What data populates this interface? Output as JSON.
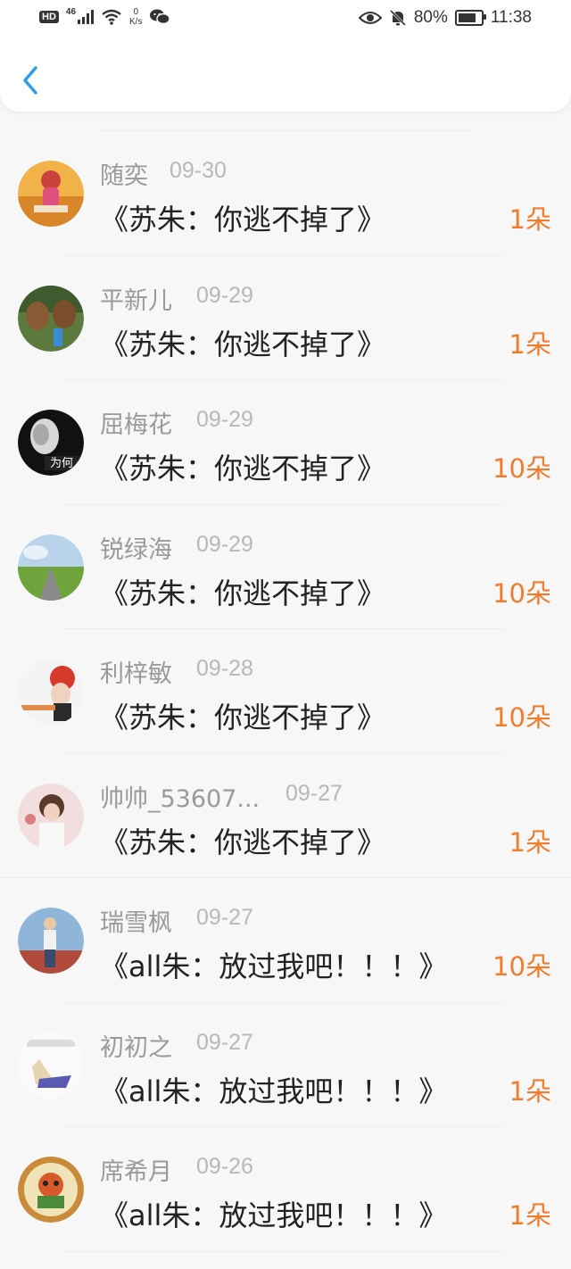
{
  "status_bar": {
    "hd": "HD",
    "network": "46",
    "speed_value": "0",
    "speed_unit": "K/s",
    "battery_percent": "80%",
    "battery_level": 0.8,
    "time": "11:38"
  },
  "list": {
    "items": [
      {
        "name": "随奕",
        "date": "09-30",
        "title": "《苏朱：你逃不掉了》",
        "count": "1朵"
      },
      {
        "name": "平新儿",
        "date": "09-29",
        "title": "《苏朱：你逃不掉了》",
        "count": "1朵"
      },
      {
        "name": "屈梅花",
        "date": "09-29",
        "title": "《苏朱：你逃不掉了》",
        "count": "10朵"
      },
      {
        "name": "锐绿海",
        "date": "09-29",
        "title": "《苏朱：你逃不掉了》",
        "count": "10朵"
      },
      {
        "name": "利梓敏",
        "date": "09-28",
        "title": "《苏朱：你逃不掉了》",
        "count": "10朵"
      },
      {
        "name": "帅帅_53607...",
        "date": "09-27",
        "title": "《苏朱：你逃不掉了》",
        "count": "1朵"
      },
      {
        "name": "瑞雪枫",
        "date": "09-27",
        "title": "《all朱：放过我吧！！！》",
        "count": "10朵"
      },
      {
        "name": "初初之",
        "date": "09-27",
        "title": "《all朱：放过我吧！！！》",
        "count": "1朵"
      },
      {
        "name": "席希月",
        "date": "09-26",
        "title": "《all朱：放过我吧！！！》",
        "count": "1朵"
      }
    ]
  },
  "colors": {
    "accent_blue": "#2d9cf0",
    "count_orange": "#f07c2c",
    "name_gray": "#9a9a9a"
  }
}
